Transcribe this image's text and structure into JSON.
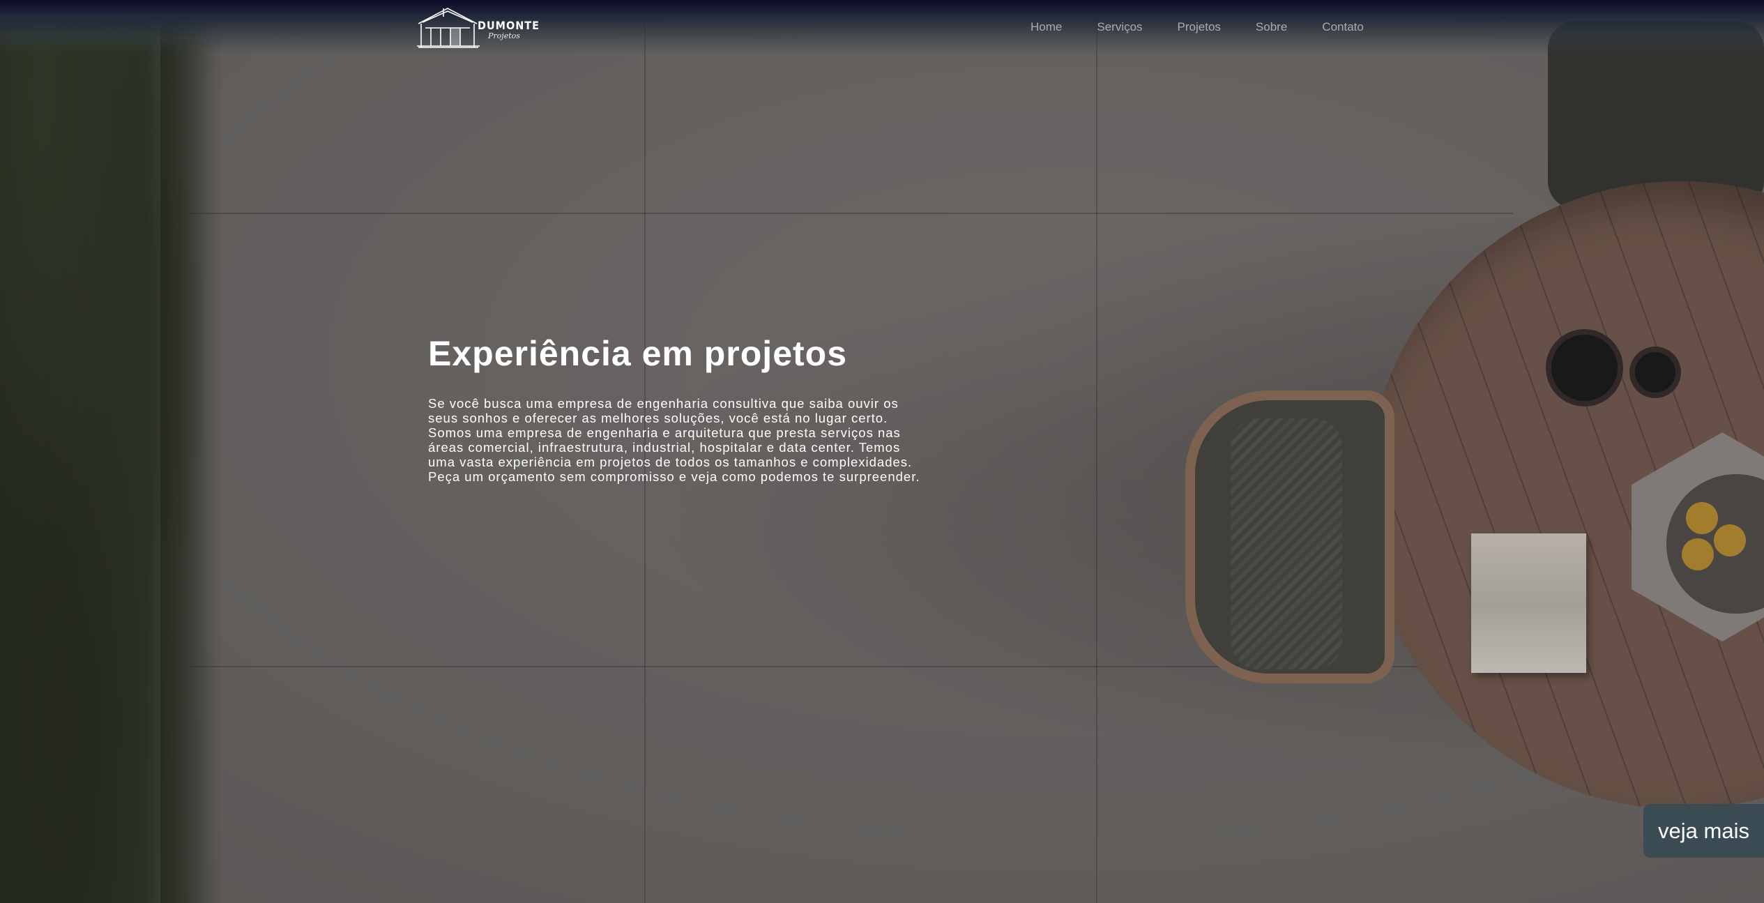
{
  "brand": {
    "name": "DUMONTE",
    "tagline": "Projetos"
  },
  "nav": {
    "items": [
      "Home",
      "Serviços",
      "Projetos",
      "Sobre",
      "Contato"
    ]
  },
  "hero": {
    "title": "Experiência em projetos",
    "description": "Se você busca uma empresa de engenharia consultiva que saiba ouvir os seus sonhos e oferecer as melhores soluções, você está no lugar certo. Somos uma empresa de engenharia e arquitetura que presta serviços nas áreas comercial, infraestrutura, industrial, hospitalar e data center. Temos uma vasta experiência em projetos de todos os tamanhos e complexidades. Peça um orçamento sem compromisso e veja como podemos te surpreender."
  },
  "cta": {
    "label": "veja mais"
  },
  "colors": {
    "nav_top": "#0b0b26",
    "cta_bg": "#3a4b53",
    "nav_link": "#a7acb0"
  }
}
